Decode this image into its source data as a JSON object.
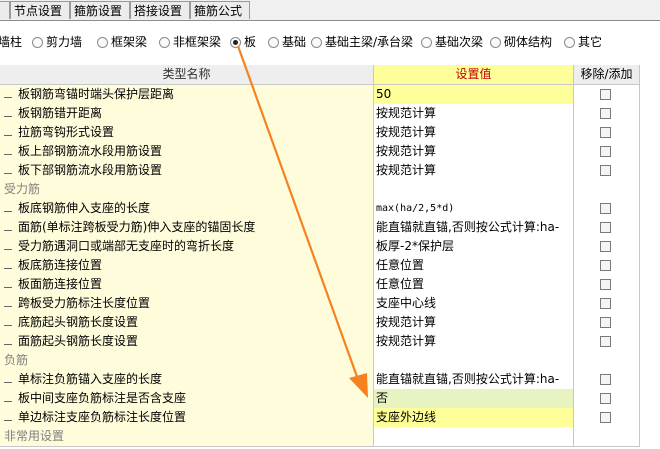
{
  "tabs": [
    "",
    "节点设置",
    "箍筋设置",
    "搭接设置",
    "箍筋公式"
  ],
  "radios": [
    {
      "label": "墙柱",
      "checked": false
    },
    {
      "label": "剪力墙",
      "checked": false
    },
    {
      "label": "框架梁",
      "checked": false
    },
    {
      "label": "非框架梁",
      "checked": false
    },
    {
      "label": "板",
      "checked": true
    },
    {
      "label": "基础",
      "checked": false
    },
    {
      "label": "基础主梁/承台梁",
      "checked": false
    },
    {
      "label": "基础次梁",
      "checked": false
    },
    {
      "label": "砌体结构",
      "checked": false
    },
    {
      "label": "其它",
      "checked": false
    }
  ],
  "table": {
    "headers": [
      "类型名称",
      "设置值",
      "移除/添加"
    ],
    "rows": [
      {
        "type": "item",
        "name": "板钢筋弯锚时端头保护层距离",
        "value": "50",
        "highlight": "yellow",
        "checkbox": true
      },
      {
        "type": "item",
        "name": "板钢筋错开距离",
        "value": "按规范计算",
        "checkbox": true
      },
      {
        "type": "item",
        "name": "拉筋弯钩形式设置",
        "value": "按规范计算",
        "checkbox": true
      },
      {
        "type": "item",
        "name": "板上部钢筋流水段用筋设置",
        "value": "按规范计算",
        "checkbox": true
      },
      {
        "type": "item",
        "name": "板下部钢筋流水段用筋设置",
        "value": "按规范计算",
        "checkbox": true
      },
      {
        "type": "group",
        "name": "受力筋",
        "value": "",
        "checkbox": false
      },
      {
        "type": "item",
        "name": "板底钢筋伸入支座的长度",
        "value": "max(ha/2,5*d)",
        "mono": true,
        "checkbox": true
      },
      {
        "type": "item",
        "name": "面筋(单标注跨板受力筋)伸入支座的锚固长度",
        "value": "能直锚就直锚,否则按公式计算:ha-",
        "checkbox": true
      },
      {
        "type": "item",
        "name": "受力筋遇洞口或端部无支座时的弯折长度",
        "value": "板厚-2*保护层",
        "checkbox": true
      },
      {
        "type": "item",
        "name": "板底筋连接位置",
        "value": "任意位置",
        "checkbox": true
      },
      {
        "type": "item",
        "name": "板面筋连接位置",
        "value": "任意位置",
        "checkbox": true
      },
      {
        "type": "item",
        "name": "跨板受力筋标注长度位置",
        "value": "支座中心线",
        "checkbox": true
      },
      {
        "type": "item",
        "name": "底筋起头钢筋长度设置",
        "value": "按规范计算",
        "checkbox": true
      },
      {
        "type": "item",
        "name": "面筋起头钢筋长度设置",
        "value": "按规范计算",
        "checkbox": true
      },
      {
        "type": "group",
        "name": "负筋",
        "value": "",
        "checkbox": false
      },
      {
        "type": "item",
        "name": "单标注负筋锚入支座的长度",
        "value": "能直锚就直锚,否则按公式计算:ha-",
        "checkbox": true
      },
      {
        "type": "item",
        "name": "板中间支座负筋标注是否含支座",
        "value": "否",
        "highlight": "green",
        "checkbox": true
      },
      {
        "type": "item",
        "name": "单边标注支座负筋标注长度位置",
        "value": "支座外边线",
        "highlight": "yellow",
        "checkbox": true
      },
      {
        "type": "group",
        "name": "非常用设置",
        "value": "",
        "checkbox": false
      }
    ]
  },
  "colors": {
    "accent_arrow": "#f5821f",
    "header_value_bg": "#ffff99",
    "name_bg": "#fffcdc"
  }
}
